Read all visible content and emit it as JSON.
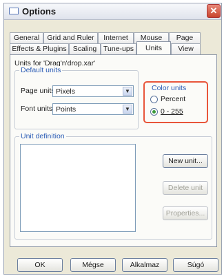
{
  "window": {
    "title": "Options",
    "close": "✕"
  },
  "tabs": {
    "row1": [
      "General",
      "Grid and Ruler",
      "Internet",
      "Mouse",
      "Page"
    ],
    "row2": [
      "Effects & Plugins",
      "Scaling",
      "Tune-ups",
      "Units",
      "View"
    ],
    "active": "Units"
  },
  "units": {
    "header": "Units for 'Drag'n'drop.xar'",
    "default_units_title": "Default units",
    "page_units_label": "Page units:",
    "page_units_value": "Pixels",
    "font_units_label": "Font units:",
    "font_units_value": "Points",
    "color_units_title": "Color units",
    "color_percent": "Percent",
    "color_0_255": "0 - 255",
    "selected_color_unit": "0 - 255",
    "unit_definition_title": "Unit definition"
  },
  "unit_buttons": {
    "new": "New unit...",
    "delete": "Delete unit",
    "properties": "Properties..."
  },
  "footer": {
    "ok": "OK",
    "cancel": "Mégse",
    "apply": "Alkalmaz",
    "help": "Súgó"
  }
}
